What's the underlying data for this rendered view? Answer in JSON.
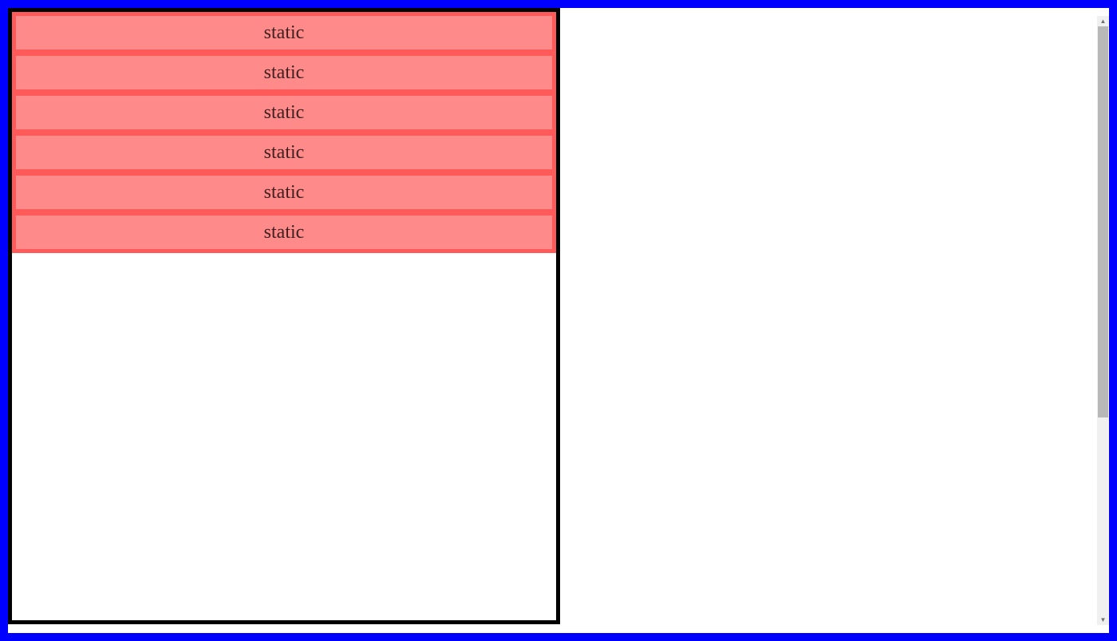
{
  "items": [
    {
      "label": "static"
    },
    {
      "label": "static"
    },
    {
      "label": "static"
    },
    {
      "label": "static"
    },
    {
      "label": "static"
    },
    {
      "label": "static"
    }
  ]
}
